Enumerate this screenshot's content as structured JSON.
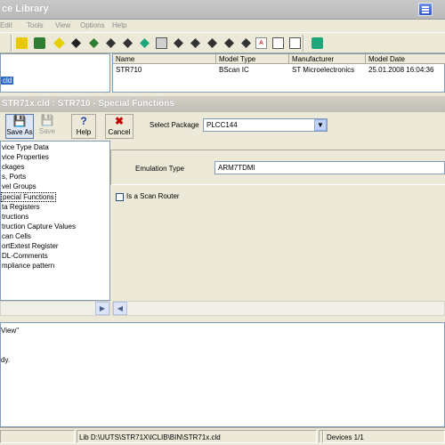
{
  "window": {
    "title": "ce Library"
  },
  "menu": [
    "Edit",
    "Tools",
    "View",
    "Options",
    "Help"
  ],
  "toolbar": {
    "icons": [
      "db-connect-icon",
      "library-icon",
      "edit-device-icon",
      "edit-device-icon",
      "edit-device-icon",
      "edit-device-icon",
      "edit-device-icon",
      "chip-icon",
      "chip-icon",
      "print-icon",
      "edit-device-icon",
      "edit-device-icon",
      "edit-device-icon",
      "edit-device-icon",
      "pdf-icon",
      "preview-icon",
      "preview-icon",
      "import-icon",
      "help-icon"
    ]
  },
  "top_tree": {
    "selected": "cld"
  },
  "device_table": {
    "columns": [
      "Name",
      "Model Type",
      "Manufacturer",
      "Model Date"
    ],
    "rows": [
      [
        "STR710",
        "BScan IC",
        "ST Microelectronics",
        "25.01.2008 16:04:36"
      ]
    ]
  },
  "child": {
    "caption": "STR71x.cld : STR710 - Special Functions",
    "buttons": {
      "save_as": "Save As",
      "save": "Save",
      "help": "Help",
      "cancel": "Cancel"
    }
  },
  "tree": {
    "items": [
      "vice Type Data",
      "vice Properties",
      "ckages",
      "s, Ports",
      "vel Groups",
      "pecial Functions",
      "ta Registers",
      "tructions",
      "truction Capture Values",
      "can Cells",
      "ortExtest Register",
      "DL-Comments",
      "mpliance pattern"
    ],
    "selected_index": 5
  },
  "panel": {
    "select_package_label": "Select Package",
    "select_package_value": "PLCC144",
    "emulation_label": "Emulation Type",
    "emulation_value": "ARM7TDMI",
    "scan_router_label": "Is a Scan Router"
  },
  "log": {
    "lines": [
      "View\"",
      "",
      "",
      "dy."
    ]
  },
  "status": {
    "path": "Lib D:\\UUTS\\STR71X\\ICLIB\\BIN\\STR71x.cld",
    "devices": "Devices 1/1"
  }
}
